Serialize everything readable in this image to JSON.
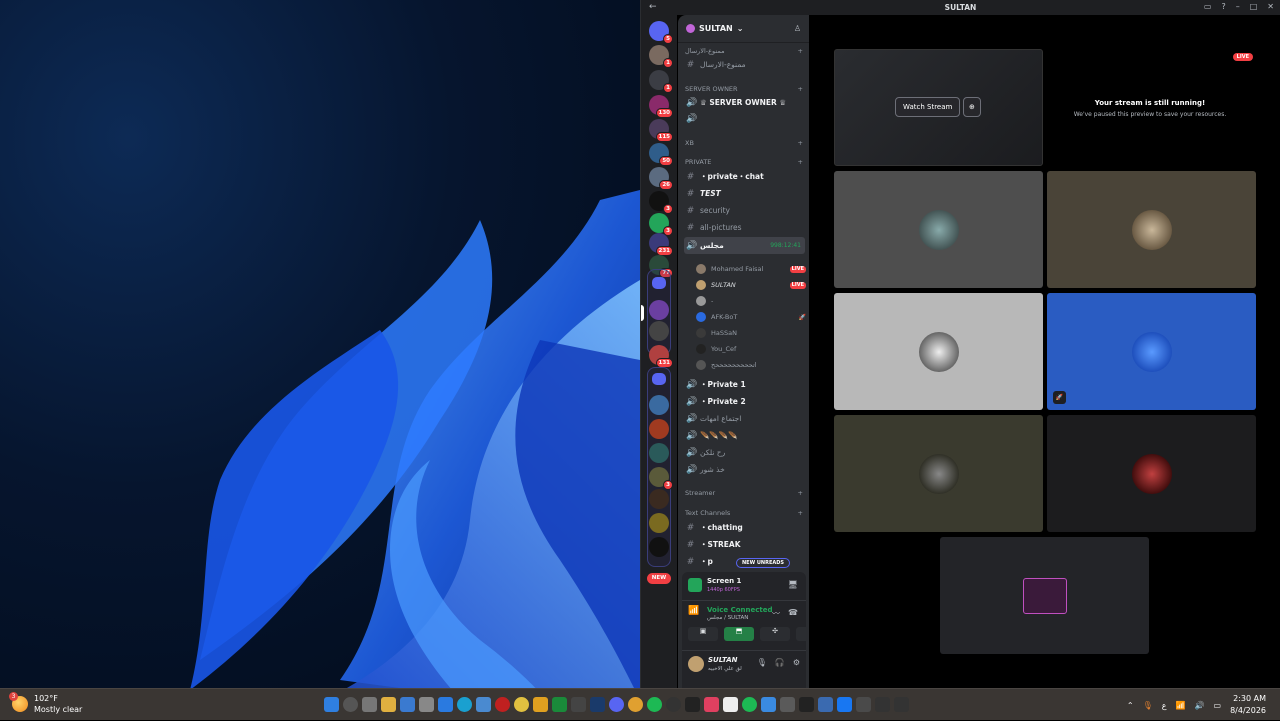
{
  "window": {
    "title": "SULTAN"
  },
  "server": {
    "name": "SULTAN"
  },
  "guild_badges": [
    "5",
    "1",
    "1",
    "130",
    "115",
    "50",
    "26",
    "3",
    "3",
    "231",
    "77",
    "131",
    "3"
  ],
  "new_pill": "NEW",
  "categories": {
    "c1": "ممنوع-الارسال",
    "c2": "SERVER OWNER",
    "c3": "XB",
    "c4": "PRIVATE",
    "c5": "Streamer",
    "c6": "Text Channels"
  },
  "channels": {
    "ch1": "ممنوع-الارسال",
    "ch2": "♕ SERVER OWNER ♕",
    "ch3": "・private・chat",
    "ch4": "TEST",
    "ch5": "security",
    "ch6": "all-pictures",
    "voice_active": "مجلس",
    "voice_timer": "998:12:41",
    "ch7": "・Private 1",
    "ch8": "・Private 2",
    "ch9": "اجتماع امهات",
    "ch10": "🪶🪶🪶🪶",
    "ch11": "رح نلكن",
    "ch12": "خذ شور",
    "ch13": "・chatting",
    "ch14": "・STREAK",
    "ch15": "・p"
  },
  "voice_users": [
    {
      "name": "Mohamed Faisal",
      "live": "LIVE"
    },
    {
      "name": "SULTAN",
      "live": "LIVE"
    },
    {
      "name": "-",
      "live": ""
    },
    {
      "name": "AFK-BoT",
      "live": ""
    },
    {
      "name": "HaSSaN",
      "live": ""
    },
    {
      "name": "You_Cef",
      "live": ""
    },
    {
      "name": "اتحححححححححح",
      "live": ""
    }
  ],
  "new_unreads": "NEW UNREADS",
  "stream_panel": {
    "title": "Screen 1",
    "sub": "1440p 60FPS"
  },
  "voice_panel": {
    "status": "Voice Connected",
    "location": "مجلس / SULTAN"
  },
  "user_panel": {
    "name": "SULTAN",
    "status": "لق علي الاخبيه"
  },
  "stage": {
    "watch_stream": "Watch Stream",
    "live": "LIVE",
    "running_title": "Your stream is still running!",
    "running_sub": "We've paused this preview to save your resources."
  },
  "taskbar": {
    "temp": "102°F",
    "weather": "Mostly clear",
    "weather_badge": "3",
    "lang": "ع",
    "time": "2:30 AM",
    "date": "8/4/2026"
  },
  "colors": {
    "accent": "#5865f2",
    "live": "#f23f43",
    "connected": "#23a55a"
  }
}
